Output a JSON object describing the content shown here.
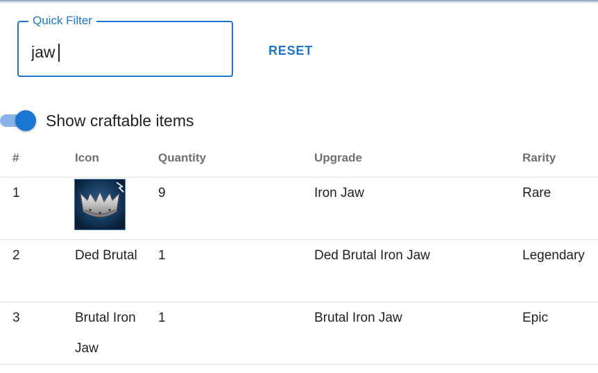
{
  "filter": {
    "label": "Quick Filter",
    "value": "jaw",
    "reset_label": "RESET"
  },
  "toggle": {
    "label": "Show craftable items",
    "checked": true
  },
  "table": {
    "columns": [
      "#",
      "Icon",
      "Quantity",
      "Upgrade",
      "Rarity"
    ],
    "rows": [
      {
        "num": "1",
        "icon": "iron-jaw-icon",
        "quantity": "9",
        "upgrade": "Iron Jaw",
        "rarity": "Rare"
      },
      {
        "num": "2",
        "icon_text": "Ded Brutal",
        "quantity": "1",
        "upgrade": "Ded Brutal Iron Jaw",
        "rarity": "Legendary"
      },
      {
        "num": "3",
        "icon_text": "Brutal Iron Jaw",
        "quantity": "1",
        "upgrade": "Brutal Iron Jaw",
        "rarity": "Epic"
      }
    ]
  },
  "colors": {
    "accent": "#1976d2",
    "toggle_track": "#8ab4e8",
    "header_text": "#6f6f6f",
    "divider": "#e0e0e0"
  }
}
